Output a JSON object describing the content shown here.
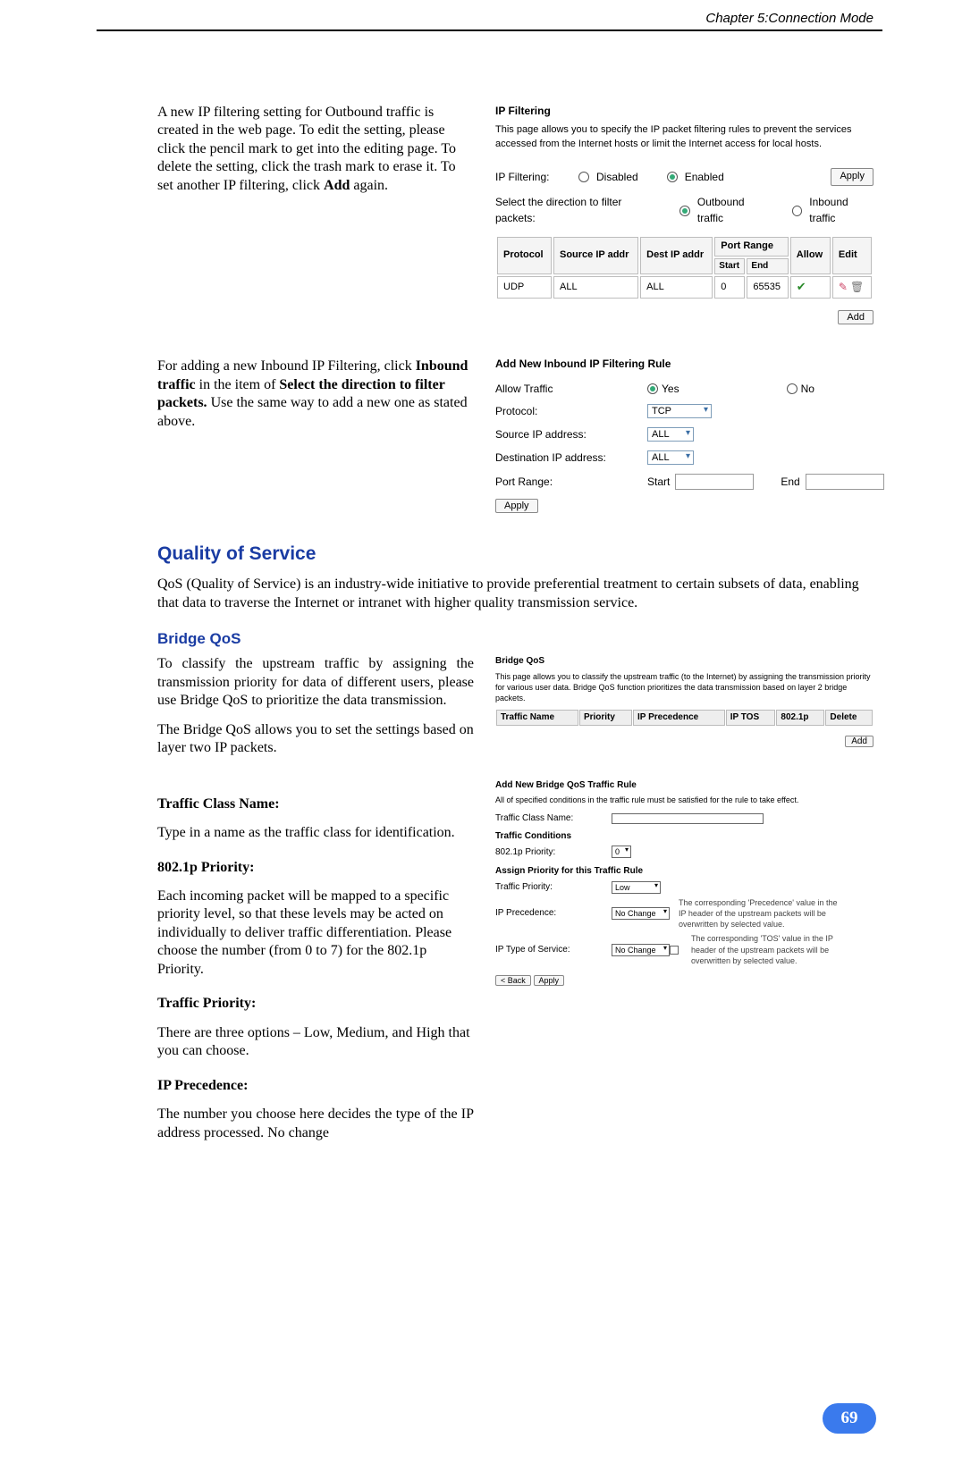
{
  "header": {
    "chapter": "Chapter 5:Connection Mode"
  },
  "section1": {
    "p1_pre": "A new IP filtering setting for Outbound traffic is created in the web page. To edit the setting, please click the pencil mark to get into the editing page. To delete the setting, click the trash mark to erase it. To set another IP filtering, click ",
    "p1_bold": "Add",
    "p1_post": " again."
  },
  "ipfilter": {
    "title": "IP Filtering",
    "desc": "This page allows you to specify the IP packet filtering rules to prevent the services accessed from the Internet hosts or limit the Internet access for local hosts.",
    "label": "IP Filtering:",
    "disabled": "Disabled",
    "enabled": "Enabled",
    "apply": "Apply",
    "select_dir": "Select the direction to filter packets:",
    "outbound": "Outbound traffic",
    "inbound": "Inbound traffic",
    "cols": {
      "protocol": "Protocol",
      "srcip": "Source IP addr",
      "dstip": "Dest IP addr",
      "portrange": "Port Range",
      "start": "Start",
      "end": "End",
      "allow": "Allow",
      "edit": "Edit"
    },
    "row": {
      "protocol": "UDP",
      "srcip": "ALL",
      "dstip": "ALL",
      "start": "0",
      "end": "65535"
    },
    "add": "Add"
  },
  "section2": {
    "pre": "For adding a new Inbound IP Filtering, click ",
    "bold1": "Inbound traffic",
    "mid1": " in the item of ",
    "bold2": "Select the direction to filter packets.",
    "post": " Use the same way to add a new one as stated above."
  },
  "inbound": {
    "title": "Add New Inbound IP Filtering Rule",
    "allow": "Allow Traffic",
    "yes": "Yes",
    "no": "No",
    "protocol": "Protocol:",
    "proto_val": "TCP",
    "srcip": "Source IP address:",
    "srcip_val": "ALL",
    "dstip": "Destination IP address:",
    "dstip_val": "ALL",
    "port": "Port Range:",
    "start": "Start",
    "end": "End",
    "apply": "Apply"
  },
  "qos_heading": "Quality of Service",
  "qos_intro": "QoS (Quality of Service) is an industry-wide initiative to provide preferential treatment to certain subsets of data, enabling that data to traverse the Internet or intranet with higher quality transmission service.",
  "bridge_heading": "Bridge QoS",
  "bridge_p1": "To classify the upstream traffic by assigning the transmission priority for data of different users, please use Bridge QoS to prioritize the data transmission.",
  "bridge_p2": "The Bridge QoS allows you to set the settings based on layer two IP packets.",
  "bridge_panel": {
    "title": "Bridge QoS",
    "desc": "This page allows you to classify the upstream traffic (to the Internet) by assigning the transmission priority for various user data. Bridge QoS function prioritizes the data transmission based on layer 2 bridge packets.",
    "cols": {
      "name": "Traffic Name",
      "priority": "Priority",
      "prec": "IP Precedence",
      "tos": "IP TOS",
      "dot1p": "802.1p",
      "delete": "Delete"
    },
    "add": "Add"
  },
  "fields": {
    "f1_label": "Traffic Class Name:",
    "f1_text": "Type in a name as the traffic class for identification.",
    "f2_label": "802.1p Priority:",
    "f2_text": "Each incoming packet will be mapped to a specific priority level, so that these levels may be acted on individually to deliver traffic differentiation. Please choose the number (from 0 to 7) for the 802.1p Priority.",
    "f3_label": "Traffic Priority:",
    "f3_text": "There are three options – Low, Medium, and High that you can choose.",
    "f4_label": "IP Precedence:",
    "f4_text": "The number you choose here decides the type of the IP address processed. No change"
  },
  "rule_panel": {
    "title": "Add New Bridge QoS Traffic Rule",
    "sub": "All of specified conditions in the traffic rule must be satisfied for the rule to take effect.",
    "tcn": "Traffic Class Name:",
    "cond": "Traffic Conditions",
    "dot1p": "802.1p Priority:",
    "dot1p_val": "0",
    "assign": "Assign Priority for this Traffic Rule",
    "tprio": "Traffic Priority:",
    "tprio_val": "Low",
    "iprec": "IP Precedence:",
    "iprec_val": "No Change",
    "iptos": "IP Type of Service:",
    "iptos_val": "No Change",
    "note1": "The corresponding 'Precedence' value in the IP header of the upstream packets will be overwritten by selected value.",
    "note2": "The corresponding 'TOS' value in the IP header of the upstream packets will be overwritten by selected value.",
    "back": "< Back",
    "apply": "Apply"
  },
  "page_number": "69"
}
